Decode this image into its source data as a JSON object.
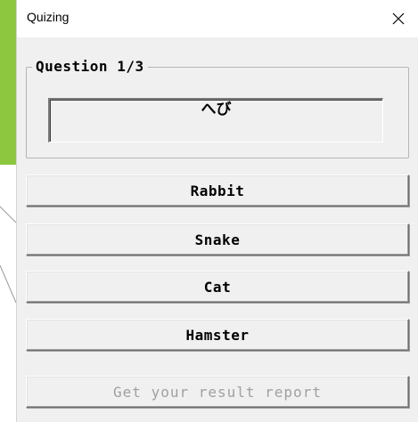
{
  "window": {
    "title": "Quizing"
  },
  "quiz": {
    "question_label": "Question 1/3",
    "word": "へび"
  },
  "options": [
    "Rabbit",
    "Snake",
    "Cat",
    "Hamster"
  ],
  "report_button": {
    "label": "Get your result report",
    "enabled": false
  },
  "colors": {
    "slide_green": "#8dc63f",
    "dialog_bg": "#f0f0f0"
  },
  "icons": {
    "close": "close-icon"
  }
}
